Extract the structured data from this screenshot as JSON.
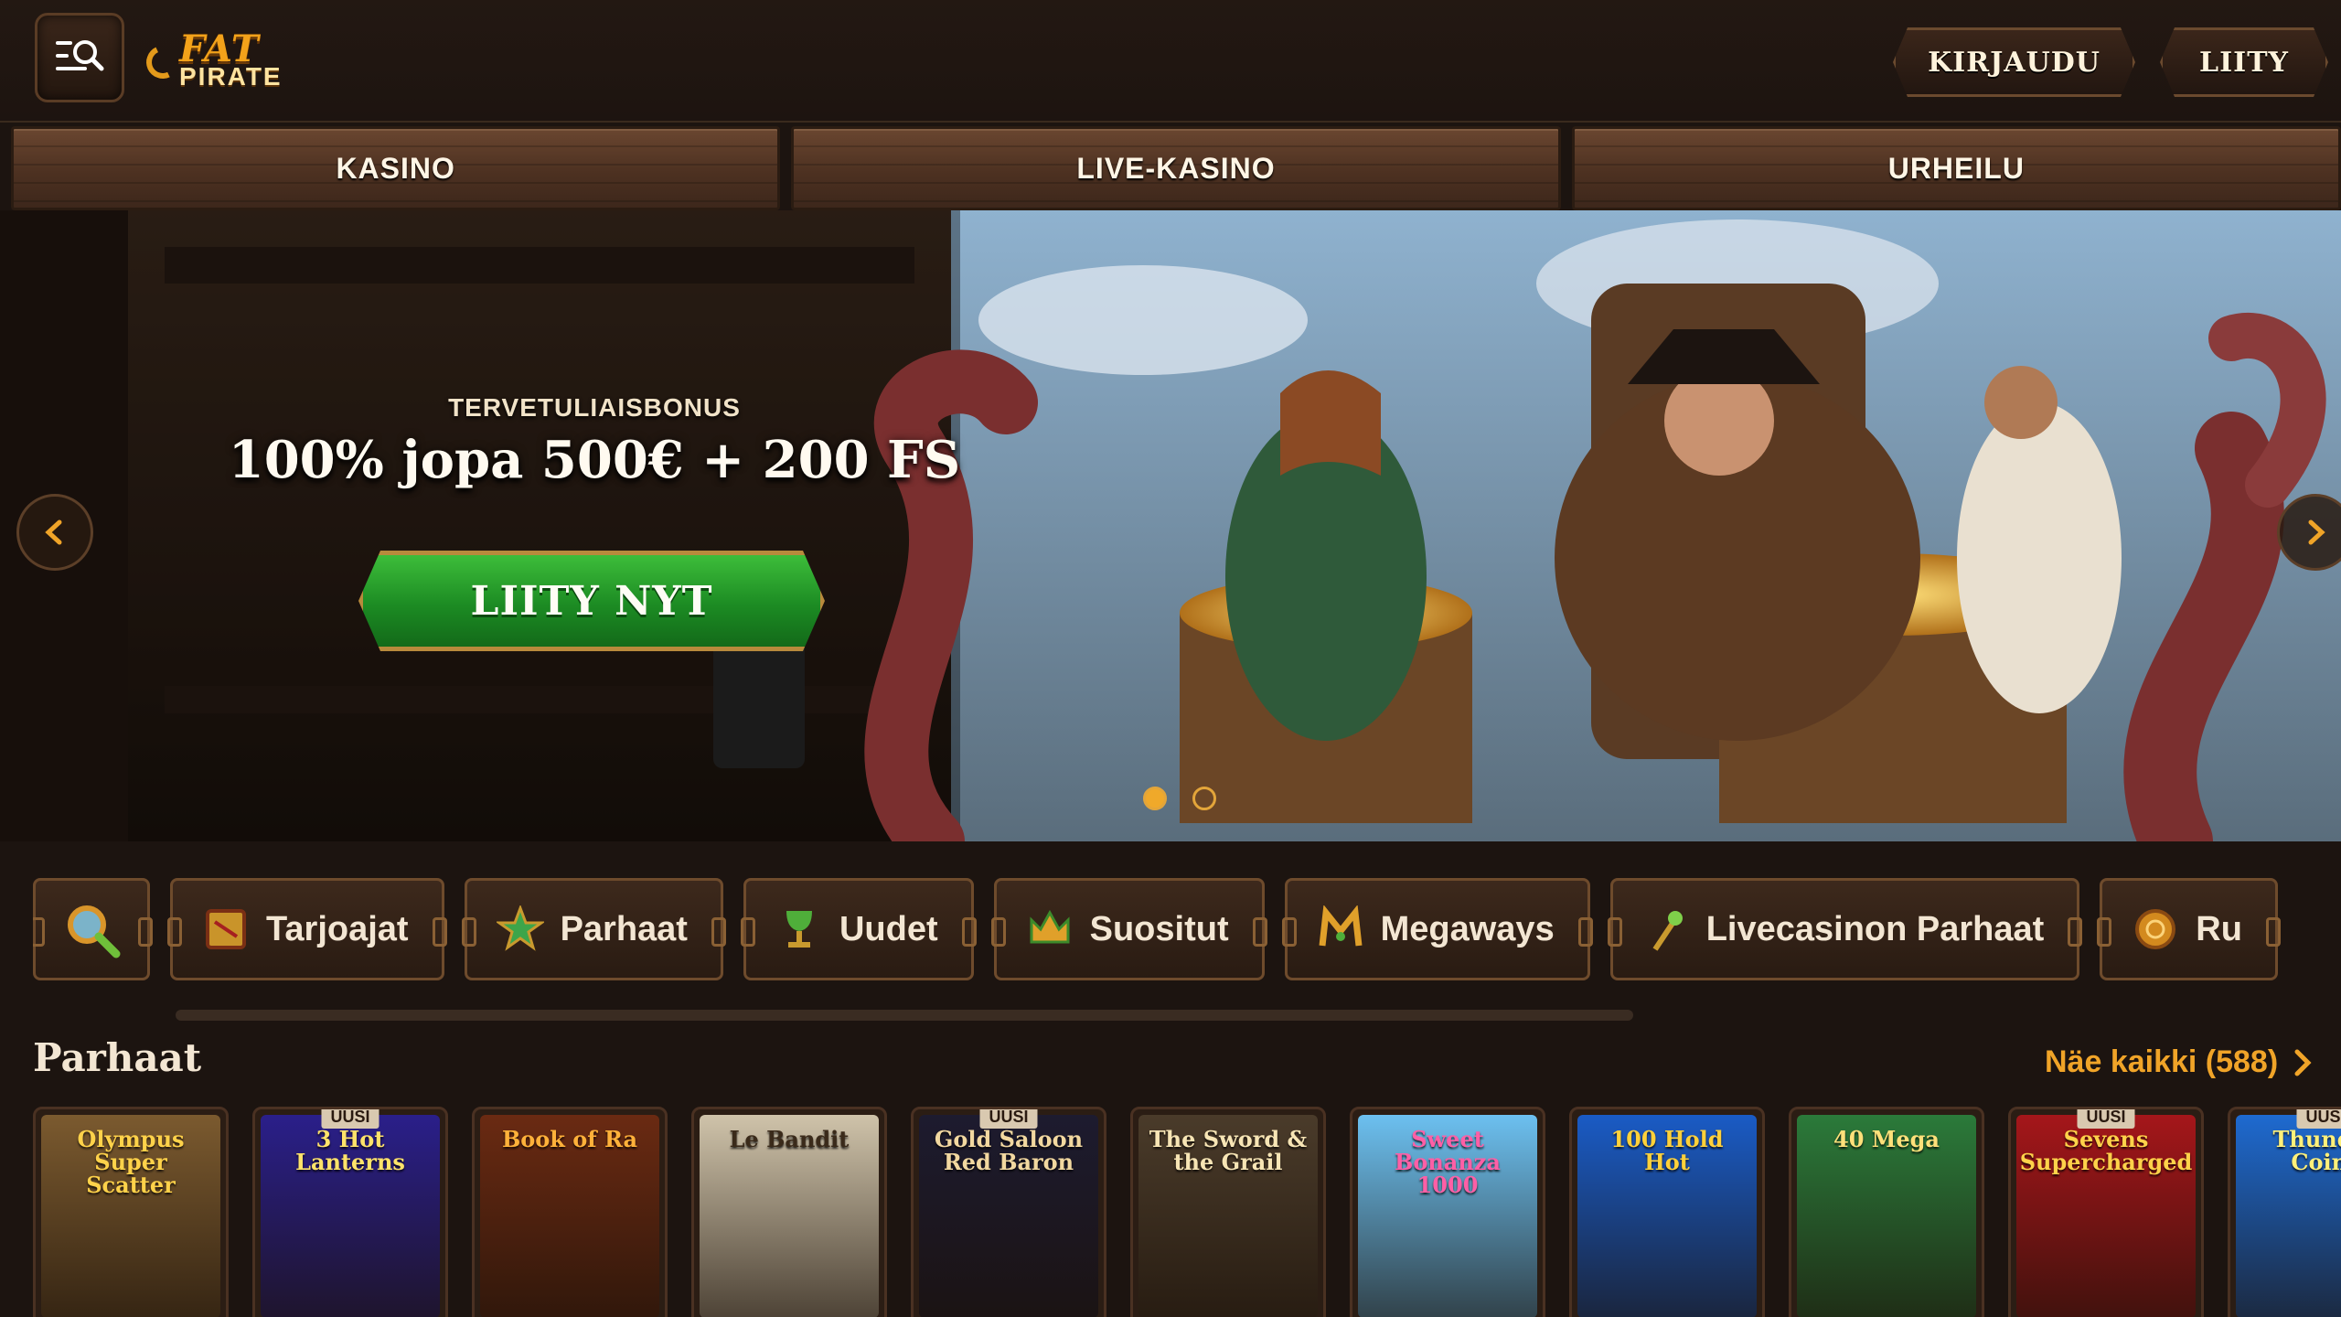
{
  "header": {
    "logo_top": "FAT",
    "logo_bottom": "PIRATE",
    "login_label": "KIRJAUDU",
    "join_label": "LIITY"
  },
  "nav": {
    "tabs": [
      {
        "label": "KASINO"
      },
      {
        "label": "LIVE-KASINO"
      },
      {
        "label": "URHEILU"
      }
    ]
  },
  "hero": {
    "kicker": "TERVETULIAISBONUS",
    "title": "100% jopa 500€ + 200 FS",
    "cta": "LIITY NYT",
    "slide_count": 2,
    "active_slide": 1
  },
  "categories": [
    {
      "label": "Tarjoajat",
      "icon": "map-icon"
    },
    {
      "label": "Parhaat",
      "icon": "star-icon"
    },
    {
      "label": "Uudet",
      "icon": "goblet-icon"
    },
    {
      "label": "Suositut",
      "icon": "crown-icon"
    },
    {
      "label": "Megaways",
      "icon": "megaways-icon"
    },
    {
      "label": "Livecasinon Parhaat",
      "icon": "torch-icon"
    },
    {
      "label": "Ru",
      "icon": "coin-icon"
    }
  ],
  "games_section": {
    "title": "Parhaat",
    "see_all": "Näe kaikki (588)",
    "badge_new": "UUSI",
    "games": [
      {
        "title": "Olympus Super Scatter",
        "new": false,
        "bg": "#7b5a2f"
      },
      {
        "title": "3 Hot Lanterns",
        "new": true,
        "bg": "#2a1f8a"
      },
      {
        "title": "Book of Ra",
        "new": false,
        "bg": "#6a2a12"
      },
      {
        "title": "Le Bandit",
        "new": false,
        "bg": "#cfc3aa"
      },
      {
        "title": "Gold Saloon Red Baron",
        "new": true,
        "bg": "#1d1b2f"
      },
      {
        "title": "The Sword & the Grail",
        "new": false,
        "bg": "#4a3b2a"
      },
      {
        "title": "Sweet Bonanza 1000",
        "new": false,
        "bg": "#6cc0f0"
      },
      {
        "title": "100 Hold Hot",
        "new": false,
        "bg": "#1a5bc5"
      },
      {
        "title": "40 Mega",
        "new": false,
        "bg": "#2b7a3a"
      },
      {
        "title": "Sevens Supercharged",
        "new": true,
        "bg": "#a5161a"
      },
      {
        "title": "Thunder Coins",
        "new": true,
        "bg": "#1e6ad0"
      }
    ]
  },
  "colors": {
    "accent": "#f0a428",
    "cta_green": "#1c8b23",
    "background": "#1c1410"
  }
}
